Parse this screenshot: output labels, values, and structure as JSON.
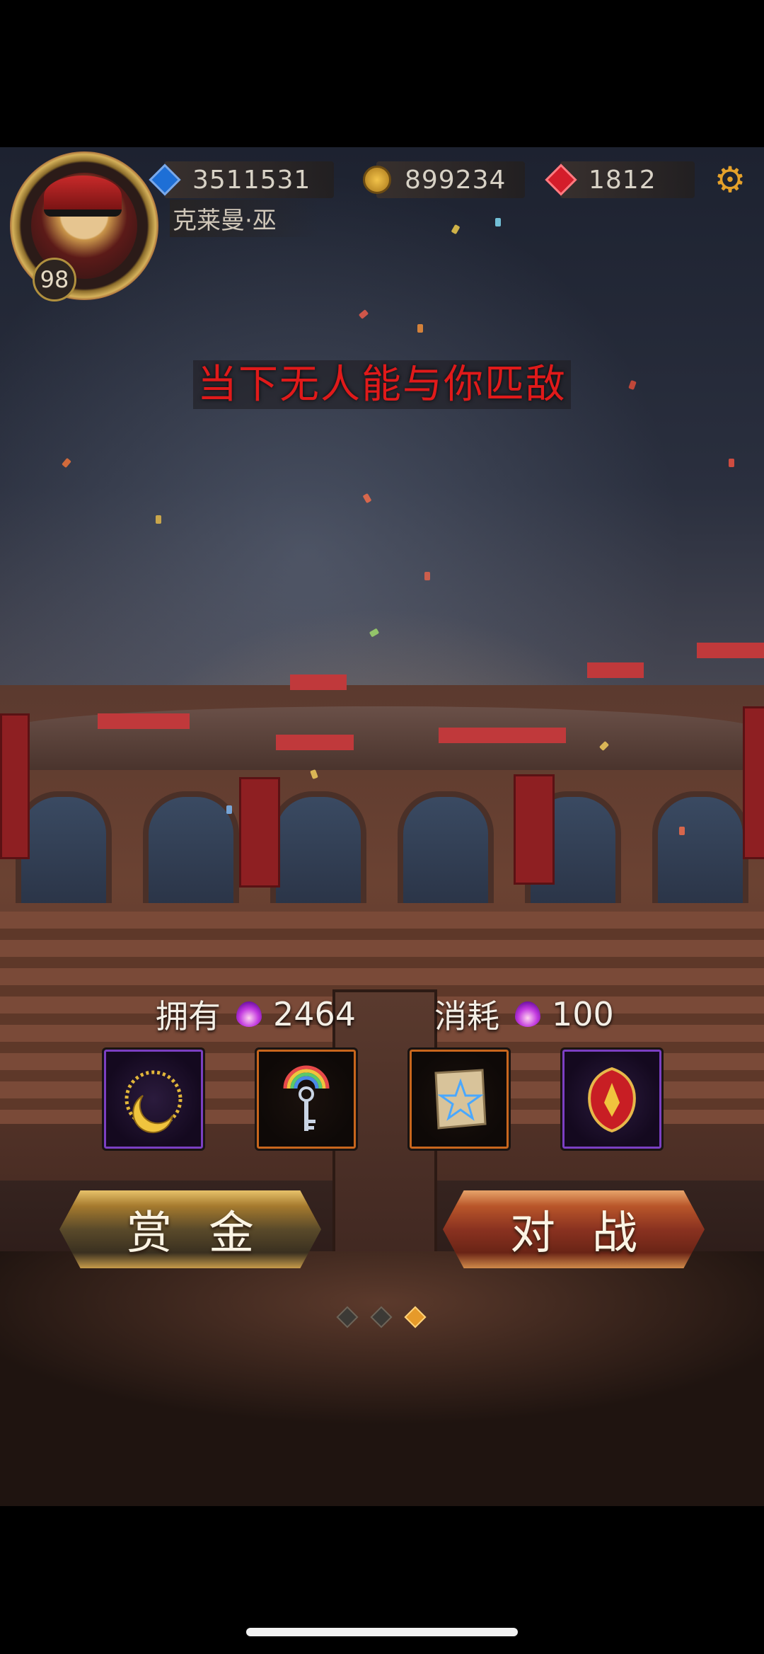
{
  "player": {
    "level": "98",
    "name": "克莱曼·巫"
  },
  "resources": [
    {
      "icon": "blue-gem-icon",
      "value": "3511531"
    },
    {
      "icon": "gold-coin-icon",
      "value": "899234"
    },
    {
      "icon": "red-gem-icon",
      "value": "1812"
    }
  ],
  "headline": "当下无人能与你匹敌",
  "stats": {
    "own_label": "拥有",
    "own_value": "2464",
    "cost_label": "消耗",
    "cost_value": "100"
  },
  "items": [
    {
      "name": "golden-crescent-necklace",
      "frame": "purple"
    },
    {
      "name": "rainbow-key",
      "frame": "orange"
    },
    {
      "name": "pentagram-scroll",
      "frame": "orange"
    },
    {
      "name": "red-crest-emblem",
      "frame": "purple"
    }
  ],
  "buttons": {
    "bounty": "赏金",
    "battle": "对战"
  },
  "pager": {
    "count": 3,
    "active_index": 2
  },
  "colors": {
    "headline": "#e01a1a",
    "gold_button": "#a57a2e",
    "red_button": "#8a3220",
    "settings": "#e5a12a"
  }
}
